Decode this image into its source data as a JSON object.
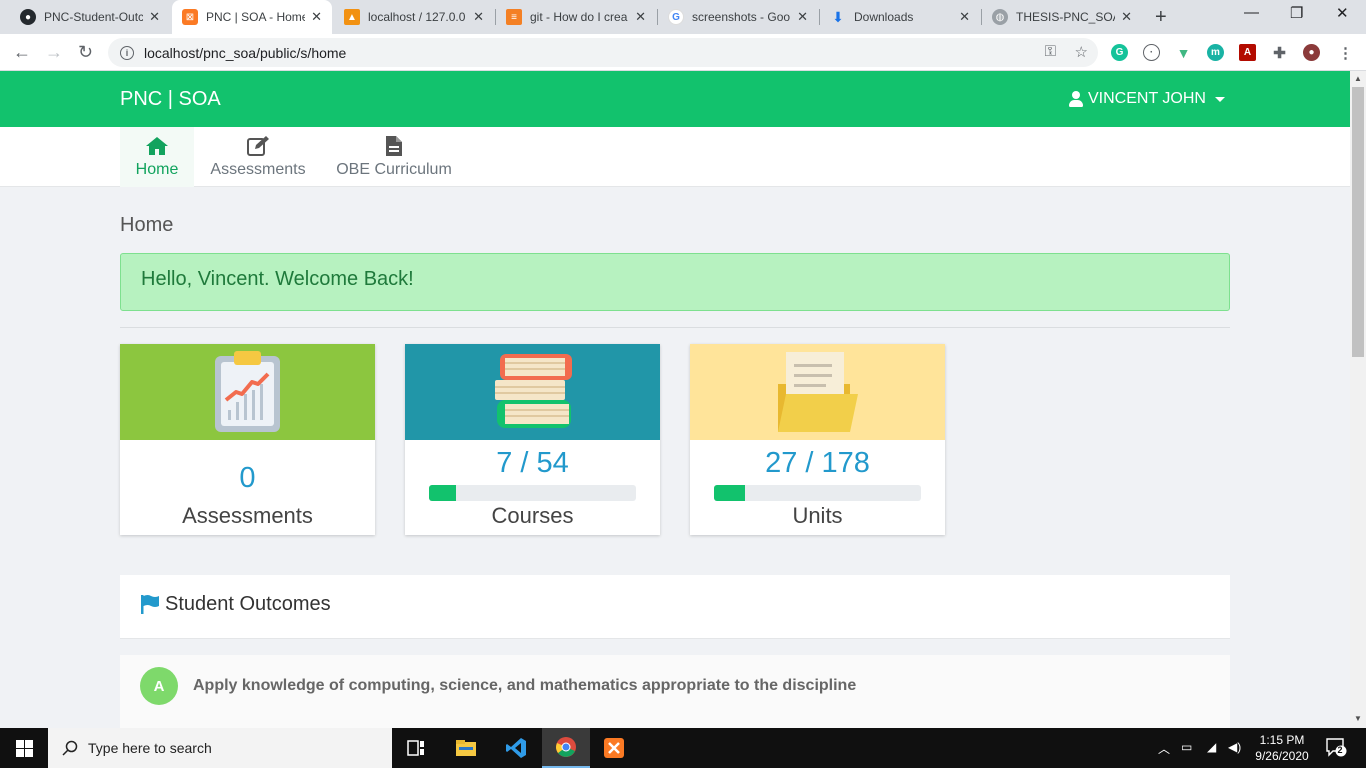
{
  "browser": {
    "tabs": [
      {
        "label": "PNC-Student-Outc",
        "icon": "github-icon"
      },
      {
        "label": "PNC | SOA - Home",
        "icon": "xampp-icon",
        "active": true
      },
      {
        "label": "localhost / 127.0.0",
        "icon": "phpmyadmin-icon"
      },
      {
        "label": "git - How do I crea",
        "icon": "stackoverflow-icon"
      },
      {
        "label": "screenshots - Goo",
        "icon": "google-icon"
      },
      {
        "label": "Downloads",
        "icon": "download-icon"
      },
      {
        "label": "THESIS-PNC_SOA-",
        "icon": "globe-icon"
      }
    ],
    "url": "localhost/pnc_soa/public/s/home"
  },
  "app": {
    "brand": "PNC | SOA",
    "user": "VINCENT JOHN",
    "nav": [
      {
        "label": "Home",
        "icon": "home-icon",
        "active": true
      },
      {
        "label": "Assessments",
        "icon": "edit-icon"
      },
      {
        "label": "OBE Curriculum",
        "icon": "document-icon"
      }
    ],
    "breadcrumb": "Home",
    "welcome": "Hello, Vincent. Welcome Back!",
    "cards": [
      {
        "value": "0",
        "label": "Assessments",
        "color": "#8cc63f",
        "icon": "clipboard-chart-icon"
      },
      {
        "value": "7 / 54",
        "label": "Courses",
        "color": "#2196a8",
        "icon": "books-icon",
        "progress": 0.13
      },
      {
        "value": "27 / 178",
        "label": "Units",
        "color": "#ffe49a",
        "icon": "folder-icon",
        "progress": 0.15
      }
    ],
    "outcomes_title": "Student Outcomes",
    "outcomes": [
      {
        "letter": "A",
        "text": "Apply knowledge of computing, science, and mathematics appropriate to the discipline"
      }
    ]
  },
  "taskbar": {
    "search_placeholder": "Type here to search",
    "time": "1:15 PM",
    "date": "9/26/2020",
    "notifications": "2"
  },
  "colors": {
    "header": "#12c26d",
    "accent_blue": "#2299cc"
  }
}
